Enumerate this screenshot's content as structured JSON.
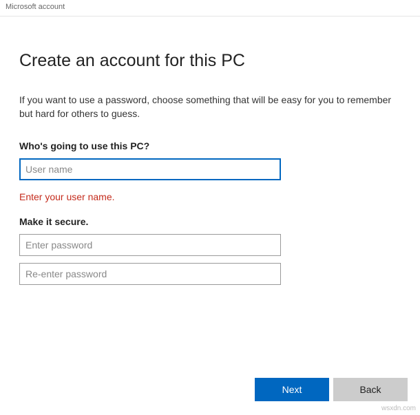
{
  "window": {
    "title": "Microsoft account"
  },
  "page": {
    "heading": "Create an account for this PC",
    "description": "If you want to use a password, choose something that will be easy for you to remember but hard for others to guess."
  },
  "section_user": {
    "label": "Who's going to use this PC?",
    "username_placeholder": "User name",
    "username_value": "",
    "error": "Enter your user name."
  },
  "section_secure": {
    "label": "Make it secure.",
    "password_placeholder": "Enter password",
    "password_value": "",
    "confirm_placeholder": "Re-enter password",
    "confirm_value": ""
  },
  "footer": {
    "next_label": "Next",
    "back_label": "Back"
  },
  "watermark": "wsxdn.com"
}
